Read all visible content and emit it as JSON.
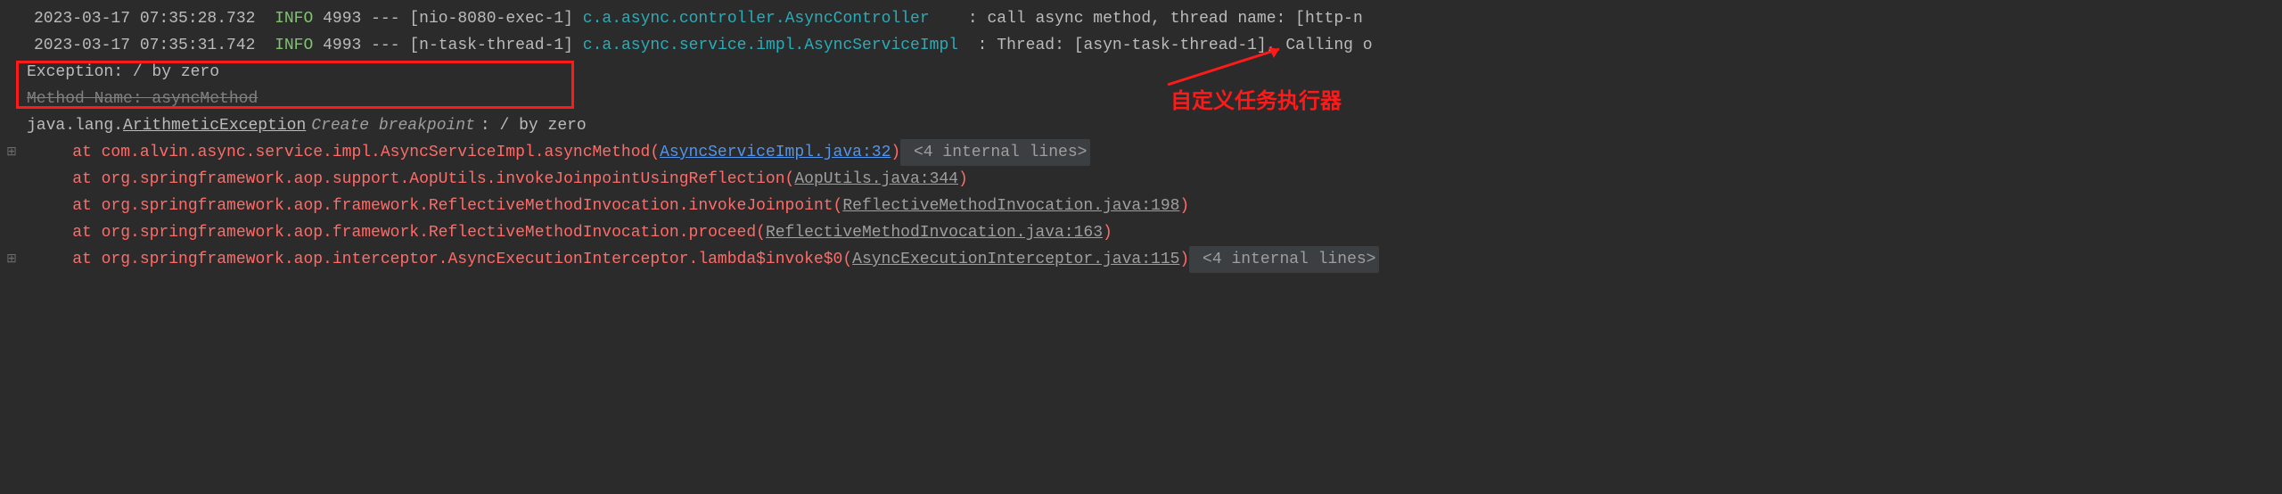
{
  "log_lines": [
    {
      "timestamp": "2023-03-17 07:35:28.732",
      "level": "INFO",
      "pid": "4993",
      "sep": "---",
      "thread": "[nio-8080-exec-1]",
      "class": "c.a.async.controller.AsyncController   ",
      "colon": " : ",
      "message": "call async method, thread name: [http-n"
    },
    {
      "timestamp": "2023-03-17 07:35:31.742",
      "level": "INFO",
      "pid": "4993",
      "sep": "---",
      "thread": "[n-task-thread-1]",
      "class": "c.a.async.service.impl.AsyncServiceImpl ",
      "colon": " : ",
      "message": "Thread: [asyn-task-thread-1], Calling o"
    }
  ],
  "exception_line": "Exception: / by zero",
  "method_name_line": "Method Name: asyncMethod",
  "ex_header": {
    "prefix": "java.lang.",
    "exception": "ArithmeticException",
    "breakpoint": "Create breakpoint",
    "suffix": ": / by zero"
  },
  "stack": [
    {
      "prefix": "    at com.alvin.async.service.impl.AsyncServiceImpl.asyncMethod(",
      "file": "AsyncServiceImpl.java:32",
      "file_type": "blue",
      "close": ")",
      "internal": " <4 internal lines>",
      "gutter": "⊞"
    },
    {
      "prefix": "    at org.springframework.aop.support.AopUtils.invokeJoinpointUsingReflection(",
      "file": "AopUtils.java:344",
      "file_type": "grey",
      "close": ")"
    },
    {
      "prefix": "    at org.springframework.aop.framework.ReflectiveMethodInvocation.invokeJoinpoint(",
      "file": "ReflectiveMethodInvocation.java:198",
      "file_type": "grey",
      "close": ")"
    },
    {
      "prefix": "    at org.springframework.aop.framework.ReflectiveMethodInvocation.proceed(",
      "file": "ReflectiveMethodInvocation.java:163",
      "file_type": "grey",
      "close": ")"
    },
    {
      "prefix": "    at org.springframework.aop.interceptor.AsyncExecutionInterceptor.lambda$invoke$0(",
      "file": "AsyncExecutionInterceptor.java:115",
      "file_type": "grey",
      "close": ")",
      "internal": " <4 internal lines>",
      "gutter": "⊞"
    }
  ],
  "annotation": "自定义任务执行器"
}
